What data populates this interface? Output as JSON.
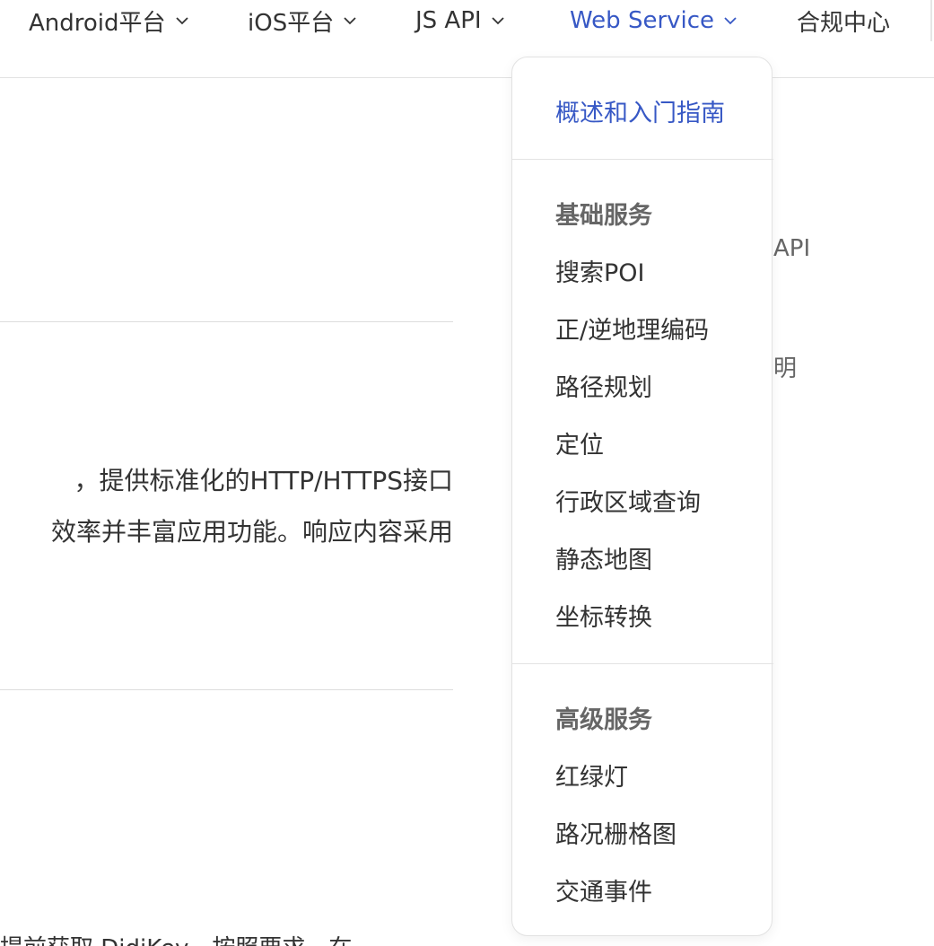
{
  "nav": {
    "items": [
      {
        "label": "Android平台"
      },
      {
        "label": "iOS平台"
      },
      {
        "label": "JS API"
      },
      {
        "label": "Web Service"
      },
      {
        "label": "合规中心"
      }
    ]
  },
  "background": {
    "paragraph_line1": "，提供标准化的HTTP/HTTPS接口",
    "paragraph_line2": "效率并丰富应用功能。响应内容采用",
    "bottom_clip": "提前获取 DidiKey，按照要求，在",
    "side_text1": "API",
    "side_text2": "明"
  },
  "dropdown": {
    "overview": "概述和入门指南",
    "basic": {
      "title": "基础服务",
      "items": [
        "搜索POI",
        "正/逆地理编码",
        "路径规划",
        "定位",
        "行政区域查询",
        "静态地图",
        "坐标转换"
      ]
    },
    "advanced": {
      "title": "高级服务",
      "items": [
        "红绿灯",
        "路况栅格图",
        "交通事件"
      ]
    }
  },
  "colors": {
    "accent": "#3758c5",
    "text": "#333333",
    "group_title": "#666666",
    "divider": "#e3e3e3"
  }
}
